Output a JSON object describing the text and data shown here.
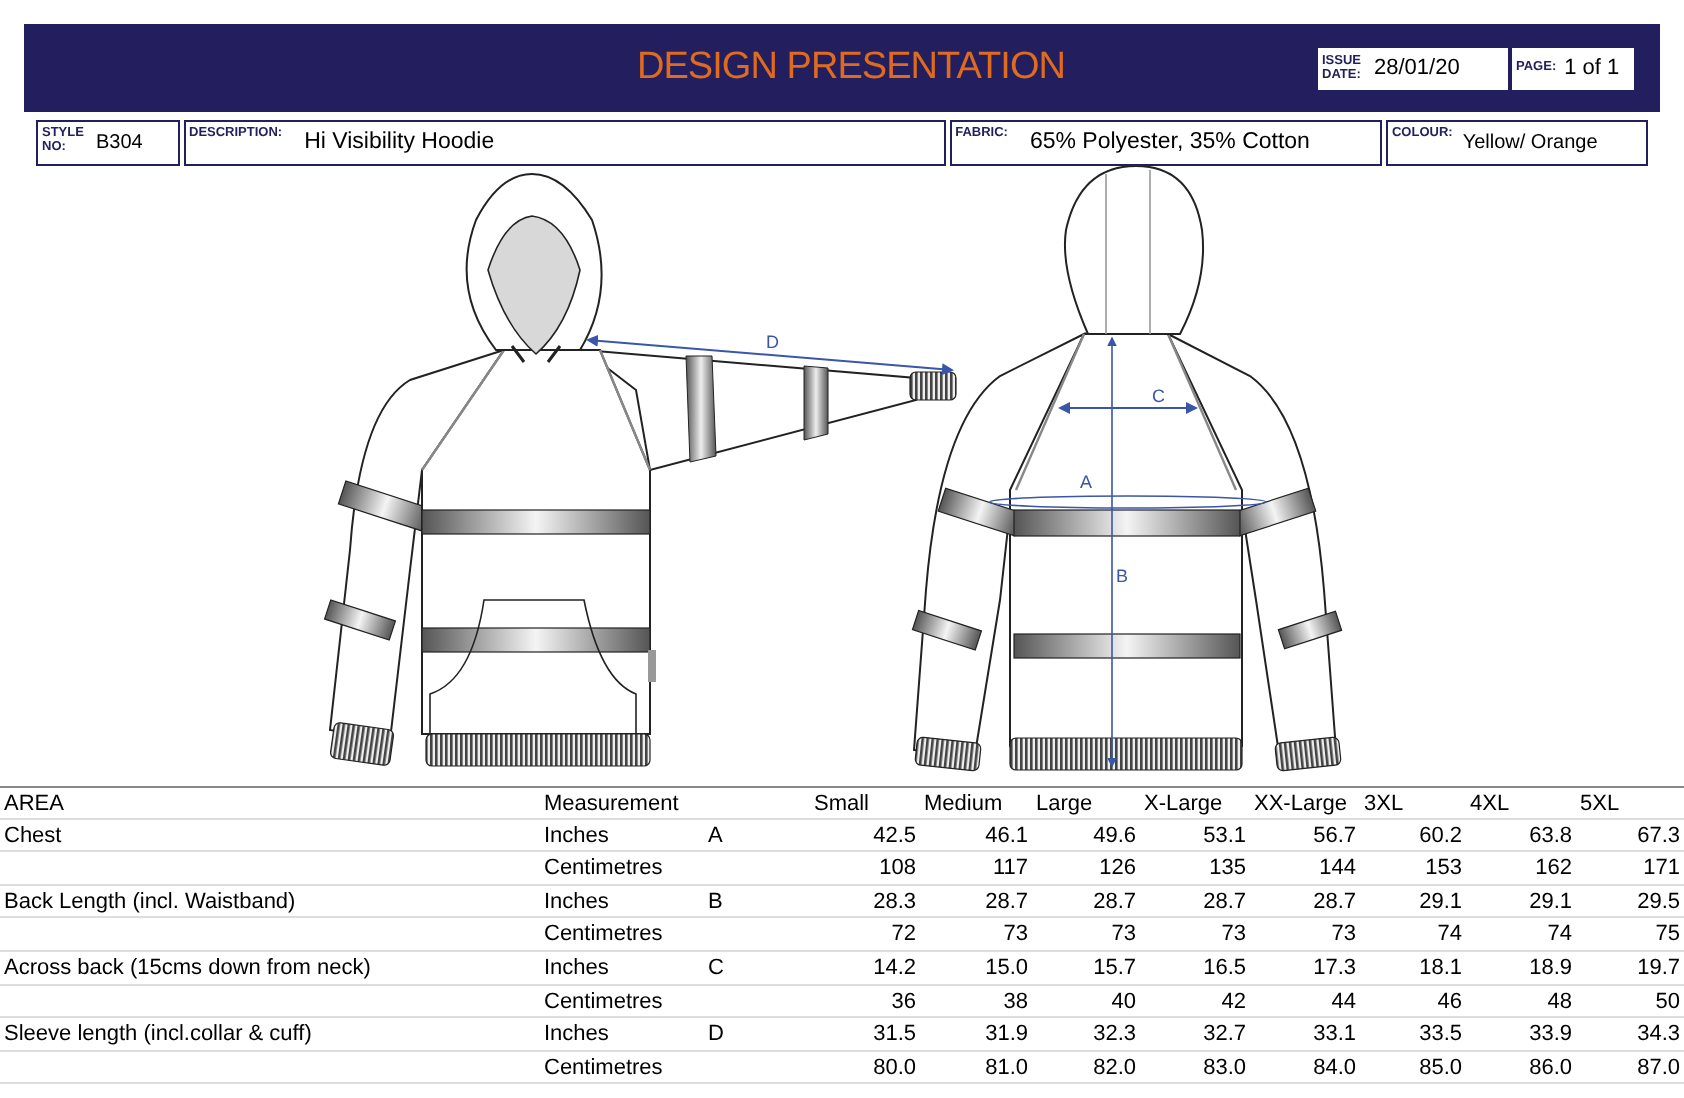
{
  "header": {
    "title": "DESIGN PRESENTATION",
    "issue": {
      "label": "ISSUE DATE:",
      "value": "28/01/20"
    },
    "page": {
      "label": "PAGE:",
      "value": "1 of 1"
    }
  },
  "info": [
    {
      "label": "STYLE NO:",
      "value": "B304"
    },
    {
      "label": "DESCRIPTION:",
      "value": "Hi Visibility Hoodie"
    },
    {
      "label": "FABRIC:",
      "value": "65% Polyester, 35% Cotton"
    },
    {
      "label": "COLOUR:",
      "value": "Yellow/ Orange"
    }
  ],
  "diagram": {
    "labels": [
      "D",
      "C",
      "A",
      "B"
    ]
  },
  "table": {
    "columns": [
      "AREA",
      "Measurement",
      "",
      "Small",
      "Medium",
      "Large",
      "X-Large",
      "XX-Large",
      "3XL",
      "4XL",
      "5XL"
    ],
    "rows": [
      {
        "area": "Chest",
        "unit": "Inches",
        "code": "A",
        "values": [
          "42.5",
          "46.1",
          "49.6",
          "53.1",
          "56.7",
          "60.2",
          "63.8",
          "67.3"
        ]
      },
      {
        "area": "",
        "unit": "Centimetres",
        "code": "",
        "values": [
          "108",
          "117",
          "126",
          "135",
          "144",
          "153",
          "162",
          "171"
        ]
      },
      {
        "area": "Back Length (incl. Waistband)",
        "unit": "Inches",
        "code": "B",
        "values": [
          "28.3",
          "28.7",
          "28.7",
          "28.7",
          "28.7",
          "29.1",
          "29.1",
          "29.5"
        ]
      },
      {
        "area": "",
        "unit": "Centimetres",
        "code": "",
        "values": [
          "72",
          "73",
          "73",
          "73",
          "73",
          "74",
          "74",
          "75"
        ]
      },
      {
        "area": "Across back (15cms down from neck)",
        "unit": "Inches",
        "code": "C",
        "values": [
          "14.2",
          "15.0",
          "15.7",
          "16.5",
          "17.3",
          "18.1",
          "18.9",
          "19.7"
        ]
      },
      {
        "area": "",
        "unit": "Centimetres",
        "code": "",
        "values": [
          "36",
          "38",
          "40",
          "42",
          "44",
          "46",
          "48",
          "50"
        ]
      },
      {
        "area": "Sleeve length (incl.collar & cuff)",
        "unit": "Inches",
        "code": "D",
        "values": [
          "31.5",
          "31.9",
          "32.3",
          "32.7",
          "33.1",
          "33.5",
          "33.9",
          "34.3"
        ]
      },
      {
        "area": "",
        "unit": "Centimetres",
        "code": "",
        "values": [
          "80.0",
          "81.0",
          "82.0",
          "83.0",
          "84.0",
          "85.0",
          "86.0",
          "87.0"
        ]
      }
    ]
  }
}
